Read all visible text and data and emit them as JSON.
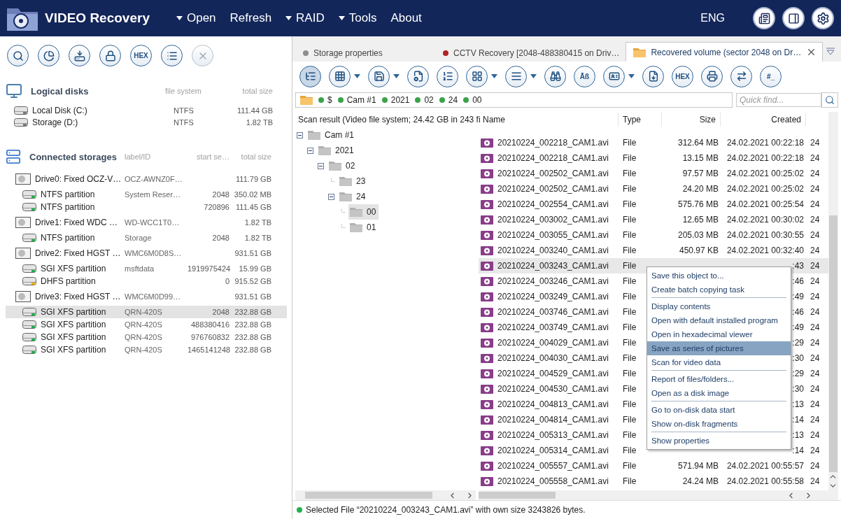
{
  "app": {
    "title": "VIDEO Recovery",
    "menu": [
      {
        "label": "Open",
        "dropdown": true
      },
      {
        "label": "Refresh",
        "dropdown": false
      },
      {
        "label": "RAID",
        "dropdown": true
      },
      {
        "label": "Tools",
        "dropdown": true
      },
      {
        "label": "About",
        "dropdown": false
      }
    ],
    "language": "ENG"
  },
  "left_toolbar": [
    {
      "kind": "icon",
      "disabled": false
    },
    {
      "kind": "icon",
      "disabled": false
    },
    {
      "kind": "icon",
      "disabled": false
    },
    {
      "kind": "icon",
      "disabled": false
    },
    {
      "kind": "text",
      "label": "HEX",
      "disabled": false
    },
    {
      "kind": "icon",
      "disabled": false
    },
    {
      "kind": "icon",
      "disabled": true
    }
  ],
  "logical_disks": {
    "title": "Logical disks",
    "columns": [
      "file system",
      "total size"
    ],
    "rows": [
      {
        "name": "Local Disk (C:)",
        "file_system": "NTFS",
        "size": "111.44 GB"
      },
      {
        "name": "Storage (D:)",
        "file_system": "NTFS",
        "size": "1.82 TB"
      }
    ]
  },
  "connected_storages": {
    "title": "Connected storages",
    "columns": [
      "label/ID",
      "start se…",
      "total size"
    ],
    "drives": [
      {
        "name": "Drive0: Fixed OCZ-V…",
        "label": "OCZ-AWNZ0F…",
        "size": "111.79 GB",
        "partitions": [
          {
            "name": "NTFS partition",
            "label": "System Reser…",
            "start": "2048",
            "size": "350.02 MB",
            "color": "#22b14c",
            "selected": false
          },
          {
            "name": "NTFS partition",
            "start": "720896",
            "size": "111.45 GB",
            "color": "#22b14c",
            "selected": false
          }
        ]
      },
      {
        "name": "Drive1: Fixed WDC …",
        "label": "WD-WCC1T0…",
        "size": "1.82 TB",
        "partitions": [
          {
            "name": "NTFS partition",
            "label": "Storage",
            "start": "2048",
            "size": "1.82 TB",
            "color": "#22b14c",
            "selected": false
          }
        ]
      },
      {
        "name": "Drive2: Fixed HGST …",
        "label": "WMC6M0D8S…",
        "size": "931.51 GB",
        "partitions": [
          {
            "name": "SGI XFS partition",
            "label": "msftdata",
            "start": "1919975424",
            "size": "15.99 GB",
            "color": "#22b14c",
            "selected": false
          },
          {
            "name": "DHFS partition",
            "start": "0",
            "size": "915.52 GB",
            "color": "#f0b400",
            "selected": false
          }
        ]
      },
      {
        "name": "Drive3: Fixed HGST …",
        "label": "WMC6M0D99…",
        "size": "931.51 GB",
        "partitions": [
          {
            "name": "SGI XFS partition",
            "label": "QRN-420S",
            "start": "2048",
            "size": "232.88 GB",
            "color": "#22b14c",
            "selected": true
          },
          {
            "name": "SGI XFS partition",
            "label": "QRN-420S",
            "start": "488380416",
            "size": "232.88 GB",
            "color": "#22b14c",
            "selected": false
          },
          {
            "name": "SGI XFS partition",
            "label": "QRN-420S",
            "start": "976760832",
            "size": "232.88 GB",
            "color": "#22b14c",
            "selected": false
          },
          {
            "name": "SGI XFS partition",
            "label": "QRN-420S",
            "start": "1465141248",
            "size": "232.88 GB",
            "color": "#22b14c",
            "selected": false
          }
        ]
      }
    ]
  },
  "tabs": [
    {
      "kind": "dot",
      "label": "Storage properties",
      "color": "#8c8c8c",
      "selected": false
    },
    {
      "kind": "dot",
      "label": "CCTV Recovery [2048-488380415 on Driv…",
      "color": "#b22222",
      "selected": false
    },
    {
      "kind": "folder",
      "label": "Recovered volume (sector 2048 on Dr…",
      "selected": true
    }
  ],
  "toolbar": [
    {
      "kind": "icon",
      "dropdown": false,
      "pressed": true
    },
    {
      "kind": "icon",
      "dropdown": true,
      "pressed": false
    },
    {
      "kind": "icon",
      "dropdown": true,
      "pressed": false
    },
    {
      "kind": "icon",
      "dropdown": false,
      "pressed": false
    },
    {
      "kind": "icon",
      "dropdown": false,
      "pressed": false
    },
    {
      "kind": "icon",
      "dropdown": true,
      "pressed": false
    },
    {
      "kind": "icon",
      "dropdown": true,
      "pressed": false
    },
    {
      "kind": "icon",
      "dropdown": false,
      "pressed": false
    },
    {
      "kind": "text",
      "label": "Āß",
      "dropdown": false,
      "pressed": false
    },
    {
      "kind": "icon",
      "dropdown": true,
      "pressed": false
    },
    {
      "kind": "icon",
      "dropdown": false,
      "pressed": false
    },
    {
      "kind": "text",
      "label": "HEX",
      "dropdown": false,
      "pressed": false
    },
    {
      "kind": "icon",
      "dropdown": false,
      "pressed": false
    },
    {
      "kind": "icon",
      "dropdown": false,
      "pressed": false
    },
    {
      "kind": "text",
      "label": "#_",
      "dropdown": false,
      "pressed": false
    }
  ],
  "breadcrumb": [
    "$",
    "Cam #1",
    "2021",
    "02",
    "24",
    "00"
  ],
  "quick_find": {
    "placeholder": "Quick find..."
  },
  "tree": {
    "title": "Scan result (Video file system; 24.42 GB in 243 fi",
    "nodes": [
      {
        "label": "Cam #1",
        "expanded": true,
        "selected": false,
        "children": [
          {
            "label": "2021",
            "expanded": true,
            "selected": false,
            "children": [
              {
                "label": "02",
                "expanded": true,
                "selected": false,
                "children": [
                  {
                    "label": "23",
                    "selected": false
                  },
                  {
                    "label": "24",
                    "expanded": true,
                    "selected": false,
                    "children": [
                      {
                        "label": "00",
                        "selected": true
                      },
                      {
                        "label": "01",
                        "selected": false
                      }
                    ]
                  }
                ]
              }
            ]
          }
        ]
      }
    ]
  },
  "table": {
    "columns": [
      "Name",
      "Type",
      "Size",
      "Created"
    ],
    "rows": [
      {
        "name": "20210224_002218_CAM1.avi",
        "type": "File",
        "size": "312.64 MB",
        "created": "24.02.2021 00:22:18",
        "column_5": "24",
        "selected": false
      },
      {
        "name": "20210224_002218_CAM1.avi",
        "type": "File",
        "size": "13.15 MB",
        "created": "24.02.2021 00:22:18",
        "column_5": "24",
        "selected": false
      },
      {
        "name": "20210224_002502_CAM1.avi",
        "type": "File",
        "size": "97.57 MB",
        "created": "24.02.2021 00:25:02",
        "column_5": "24",
        "selected": false
      },
      {
        "name": "20210224_002502_CAM1.avi",
        "type": "File",
        "size": "24.20 MB",
        "created": "24.02.2021 00:25:02",
        "column_5": "24",
        "selected": false
      },
      {
        "name": "20210224_002554_CAM1.avi",
        "type": "File",
        "size": "575.76 MB",
        "created": "24.02.2021 00:25:54",
        "column_5": "24",
        "selected": false
      },
      {
        "name": "20210224_003002_CAM1.avi",
        "type": "File",
        "size": "12.65 MB",
        "created": "24.02.2021 00:30:02",
        "column_5": "24",
        "selected": false
      },
      {
        "name": "20210224_003055_CAM1.avi",
        "type": "File",
        "size": "205.03 MB",
        "created": "24.02.2021 00:30:55",
        "column_5": "24",
        "selected": false
      },
      {
        "name": "20210224_003240_CAM1.avi",
        "type": "File",
        "size": "450.97 KB",
        "created": "24.02.2021 00:32:40",
        "column_5": "24",
        "selected": false
      },
      {
        "name": "20210224_003243_CAM1.avi",
        "type": "File",
        "created": ":43",
        "column_5": "24",
        "selected": true
      },
      {
        "name": "20210224_003246_CAM1.avi",
        "type": "File",
        "created": ":46",
        "column_5": "24",
        "selected": false
      },
      {
        "name": "20210224_003249_CAM1.avi",
        "type": "File",
        "created": ":49",
        "column_5": "24",
        "selected": false
      },
      {
        "name": "20210224_003746_CAM1.avi",
        "type": "File",
        "created": ":46",
        "column_5": "24",
        "selected": false
      },
      {
        "name": "20210224_003749_CAM1.avi",
        "type": "File",
        "created": ":49",
        "column_5": "24",
        "selected": false
      },
      {
        "name": "20210224_004029_CAM1.avi",
        "type": "File",
        "created": ":29",
        "column_5": "24",
        "selected": false
      },
      {
        "name": "20210224_004030_CAM1.avi",
        "type": "File",
        "created": ":30",
        "column_5": "24",
        "selected": false
      },
      {
        "name": "20210224_004529_CAM1.avi",
        "type": "File",
        "created": ":29",
        "column_5": "24",
        "selected": false
      },
      {
        "name": "20210224_004530_CAM1.avi",
        "type": "File",
        "created": ":30",
        "column_5": "24",
        "selected": false
      },
      {
        "name": "20210224_004813_CAM1.avi",
        "type": "File",
        "created": ":13",
        "column_5": "24",
        "selected": false
      },
      {
        "name": "20210224_004814_CAM1.avi",
        "type": "File",
        "created": ":14",
        "column_5": "24",
        "selected": false
      },
      {
        "name": "20210224_005313_CAM1.avi",
        "type": "File",
        "created": ":13",
        "column_5": "24",
        "selected": false
      },
      {
        "name": "20210224_005314_CAM1.avi",
        "type": "File",
        "created": ":14",
        "column_5": "24",
        "selected": false
      },
      {
        "name": "20210224_005557_CAM1.avi",
        "type": "File",
        "size": "571.94 MB",
        "created": "24.02.2021 00:55:57",
        "column_5": "24",
        "selected": false
      },
      {
        "name": "20210224_005558_CAM1.avi",
        "type": "File",
        "size": "24.24 MB",
        "created": "24.02.2021 00:55:58",
        "column_5": "24",
        "selected": false
      }
    ]
  },
  "context_menu": [
    [
      {
        "label": "Save this object to...",
        "selected": false
      },
      {
        "label": "Create batch copying task",
        "selected": false
      }
    ],
    [
      {
        "label": "Display contents",
        "selected": false
      },
      {
        "label": "Open with default installed program",
        "selected": false
      },
      {
        "label": "Open in hexadecimal viewer",
        "selected": false
      },
      {
        "label": "Save as series of pictures",
        "selected": true
      },
      {
        "label": "Scan for video data",
        "selected": false
      }
    ],
    [
      {
        "label": "Report of files/folders...",
        "selected": false
      },
      {
        "label": "Open as a disk image",
        "selected": false
      }
    ],
    [
      {
        "label": "Go to on-disk data start",
        "selected": false
      },
      {
        "label": "Show on-disk fragments",
        "selected": false
      }
    ],
    [
      {
        "label": "Show properties",
        "selected": false
      }
    ]
  ],
  "status_bar": {
    "text": "Selected File “20210224_003243_CAM1.avi” with own size 3243826 bytes.",
    "color": "#22b14c"
  }
}
